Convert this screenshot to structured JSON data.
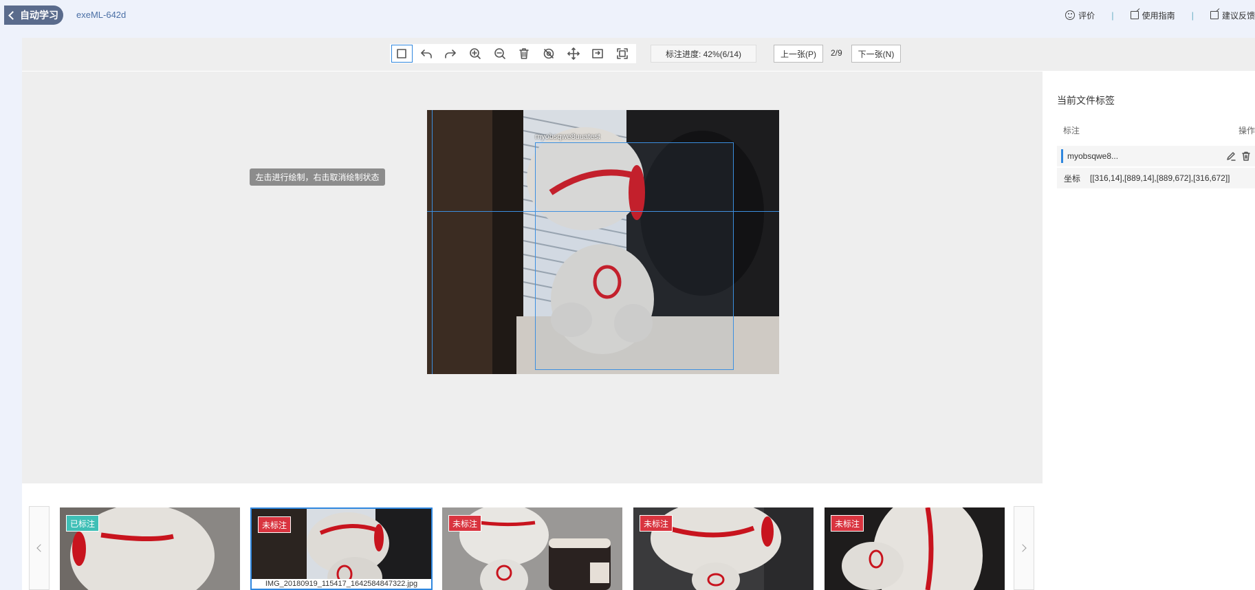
{
  "header": {
    "back_label": "自动学习",
    "project_name": "exeML-642d",
    "actions": [
      {
        "label": "评价",
        "icon": "smile-icon"
      },
      {
        "label": "使用指南",
        "icon": "edit-doc-icon"
      },
      {
        "label": "建议反馈",
        "icon": "feedback-icon"
      }
    ]
  },
  "toolbar": {
    "tools": [
      {
        "name": "rectangle-tool",
        "icon": "square-icon",
        "active": true
      },
      {
        "name": "undo-button",
        "icon": "undo-icon"
      },
      {
        "name": "redo-button",
        "icon": "redo-icon"
      },
      {
        "name": "zoom-in-button",
        "icon": "zoom-in-icon"
      },
      {
        "name": "zoom-out-button",
        "icon": "zoom-out-icon"
      },
      {
        "name": "delete-button",
        "icon": "trash-icon"
      },
      {
        "name": "hide-button",
        "icon": "eye-off-icon"
      },
      {
        "name": "move-button",
        "icon": "move-icon"
      },
      {
        "name": "fit-button",
        "icon": "fit-icon"
      },
      {
        "name": "fullscreen-button",
        "icon": "fullscreen-icon"
      }
    ],
    "progress_label": "标注进度: 42%(6/14)",
    "prev_label": "上一张(P)",
    "page_count": "2/9",
    "next_label": "下一张(N)"
  },
  "canvas": {
    "hint": "左击进行绘制，右击取消绘制状态",
    "bbox_label": "myobsqwe8uuatest"
  },
  "right_panel": {
    "title": "当前文件标签",
    "col_label": "标注",
    "col_ops": "操作",
    "label_name": "myobsqwe8...",
    "coord_key": "坐标",
    "coord_value": "[[316,14],[889,14],[889,672],[316,672]]"
  },
  "thumbnails": [
    {
      "badge": "已标注",
      "status": "done",
      "filename": ""
    },
    {
      "badge": "未标注",
      "status": "todo",
      "filename": "IMG_20180919_115417_1642584847322.jpg",
      "selected": true
    },
    {
      "badge": "未标注",
      "status": "todo",
      "filename": ""
    },
    {
      "badge": "未标注",
      "status": "todo",
      "filename": ""
    },
    {
      "badge": "未标注",
      "status": "todo",
      "filename": ""
    }
  ]
}
